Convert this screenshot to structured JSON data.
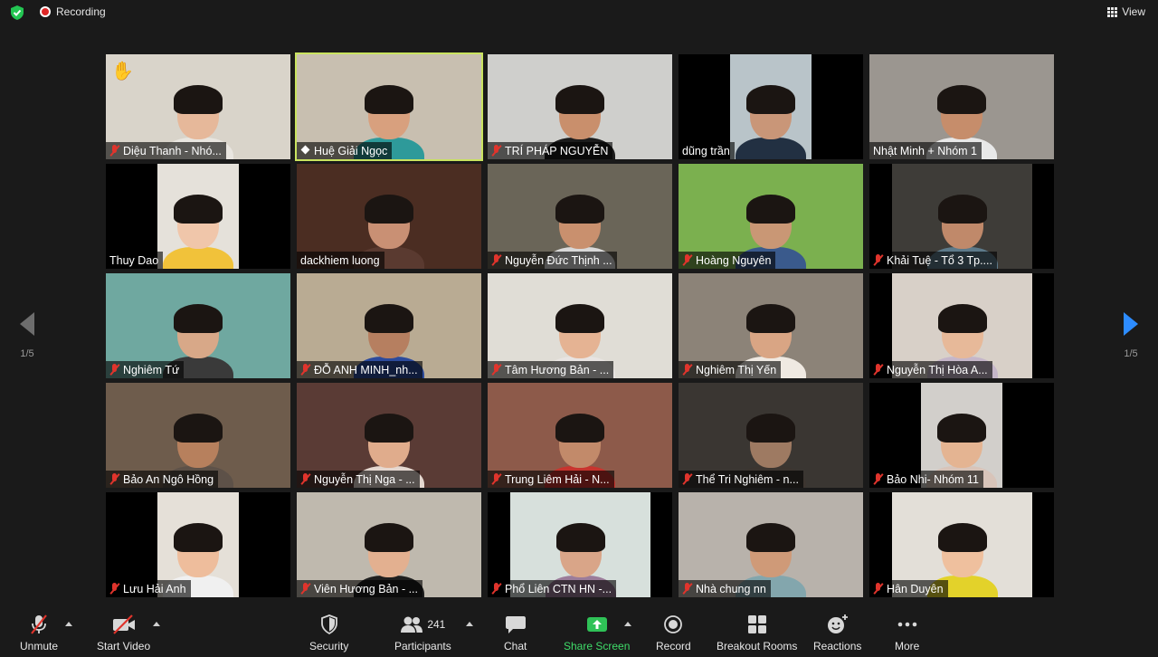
{
  "topbar": {
    "recording_label": "Recording",
    "view_label": "View",
    "colors": {
      "recording": "#e02828",
      "shield": "#23c552"
    }
  },
  "pager": {
    "left_count": "1/5",
    "right_count": "1/5"
  },
  "participants": [
    {
      "name": "Diệu Thanh - Nhó...",
      "muted": true,
      "hand_raised": true,
      "bg": "#d9d4ca",
      "skin": "#e6b89a",
      "shirt": "#e9e6e0"
    },
    {
      "name": "Huệ Giải Ngọc",
      "muted": false,
      "active_speaker": true,
      "bg": "#c8bfb0",
      "skin": "#d8a07e",
      "shirt": "#2e9a9a"
    },
    {
      "name": "TRÍ PHÁP NGUYỄN",
      "muted": true,
      "bg": "#cfcfcc",
      "skin": "#c98f6c",
      "shirt": "#1c1c1c"
    },
    {
      "name": "dũng trần",
      "muted": false,
      "bg": "#b9c4c9",
      "skin": "#c99678",
      "shirt": "#223042"
    },
    {
      "name": "Nhật Minh + Nhóm 1",
      "muted": false,
      "bg": "#9b9690",
      "skin": "#c68d6b",
      "shirt": "#e8e8e8"
    },
    {
      "name": "Thuy Dao",
      "muted": false,
      "bg": "#e5e1da",
      "skin": "#f0c6aa",
      "shirt": "#f1c23a"
    },
    {
      "name": "dackhiem luong",
      "muted": false,
      "bg": "#4b2d22",
      "skin": "#c99074",
      "shirt": "#5a3a30"
    },
    {
      "name": "Nguyễn Đức Thịnh ...",
      "muted": true,
      "bg": "#6a6558",
      "skin": "#c9906e",
      "shirt": "#d9d9d9"
    },
    {
      "name": "Hoàng Nguyên",
      "muted": true,
      "bg": "#7bb04f",
      "skin": "#c99775",
      "shirt": "#3a5a8c"
    },
    {
      "name": "Khải Tuệ - Tổ 3 Tp....",
      "muted": true,
      "bg": "#3e3c38",
      "skin": "#c0896a",
      "shirt": "#5d7a8a"
    },
    {
      "name": "Nghiêm Tứ",
      "muted": true,
      "bg": "#6fa8a0",
      "skin": "#d8a888",
      "shirt": "#3a3a3a"
    },
    {
      "name": "ĐỖ ANH MINH_nh...",
      "muted": true,
      "bg": "#b9ab93",
      "skin": "#b67f60",
      "shirt": "#2c4a9c"
    },
    {
      "name": "Tâm Hương Bản - ...",
      "muted": true,
      "bg": "#e0ddd6",
      "skin": "#e5b393",
      "shirt": "#e8e4e2"
    },
    {
      "name": "Nghiêm Thị Yến",
      "muted": true,
      "bg": "#8c8378",
      "skin": "#d9a584",
      "shirt": "#efe9e2"
    },
    {
      "name": "Nguyễn Thị Hòa A...",
      "muted": true,
      "bg": "#d8d0c8",
      "skin": "#e7b999",
      "shirt": "#c5b6c9"
    },
    {
      "name": "Bảo An Ngô Hồng",
      "muted": true,
      "bg": "#6e5c4c",
      "skin": "#b7805d",
      "shirt": "#5d5148"
    },
    {
      "name": "Nguyễn Thị Nga - ...",
      "muted": true,
      "bg": "#5a3b35",
      "skin": "#e0ac8c",
      "shirt": "#e5d8d0"
    },
    {
      "name": "Trung Liêm Hải - N...",
      "muted": true,
      "bg": "#8d5a4a",
      "skin": "#c28a6a",
      "shirt": "#c8342e"
    },
    {
      "name": "Thể Tri Nghiêm - n...",
      "muted": true,
      "bg": "#3a3632",
      "skin": "#9e7a62",
      "shirt": "#3c3530"
    },
    {
      "name": "Bảo Nhi- Nhóm 11",
      "muted": true,
      "bg": "#d2cfcb",
      "skin": "#e4b492",
      "shirt": "#d8c4b9"
    },
    {
      "name": "Lưu Hải Anh",
      "muted": true,
      "bg": "#e5e0d8",
      "skin": "#eebd9c",
      "shirt": "#f0f0f0"
    },
    {
      "name": "Viên Hương Bản - ...",
      "muted": true,
      "bg": "#bfb9ae",
      "skin": "#e3b090",
      "shirt": "#1e1e1e"
    },
    {
      "name": "Phổ Liên CTN HN -...",
      "muted": true,
      "bg": "#d7e0dc",
      "skin": "#d9a588",
      "shirt": "#9b7c9a"
    },
    {
      "name": "Nhà chung nn",
      "muted": true,
      "bg": "#b8b2ab",
      "skin": "#cf9a78",
      "shirt": "#83a6ad"
    },
    {
      "name": "Hân Duyên",
      "muted": true,
      "bg": "#e3dfd8",
      "skin": "#efc09e",
      "shirt": "#e3d22a"
    }
  ],
  "toolbar": {
    "unmute_label": "Unmute",
    "start_video_label": "Start Video",
    "security_label": "Security",
    "participants_label": "Participants",
    "participants_count": "241",
    "chat_label": "Chat",
    "share_screen_label": "Share Screen",
    "record_label": "Record",
    "breakout_label": "Breakout Rooms",
    "reactions_label": "Reactions",
    "more_label": "More",
    "colors": {
      "share": "#3fdc69",
      "muted": "#e0342c"
    }
  }
}
